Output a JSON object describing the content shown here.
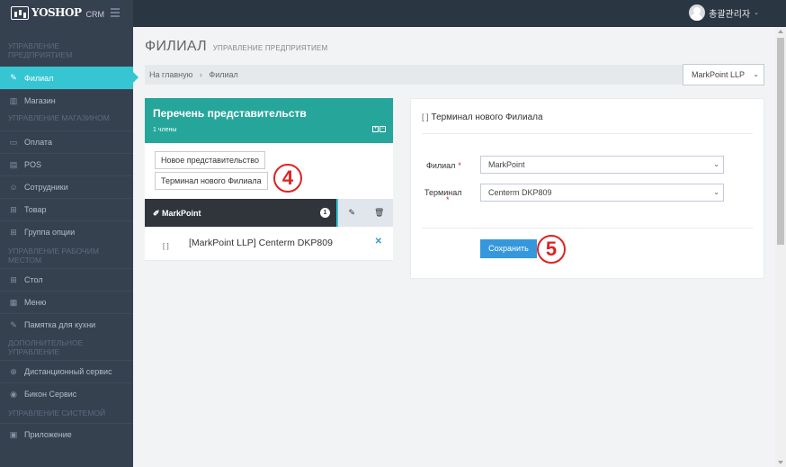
{
  "brand": {
    "name": "YOSHOP",
    "suffix": "CRM"
  },
  "user": {
    "name": "총괄관리자"
  },
  "sidebar": {
    "sections": [
      {
        "heading": "УПРАВЛЕНИЕ ПРЕДПРИЯТИЕМ",
        "items": [
          {
            "label": "Филиал",
            "icon": "edit-icon",
            "active": true
          },
          {
            "label": "Магазин",
            "icon": "store-icon"
          }
        ]
      },
      {
        "heading": "УПРАВЛЕНИЕ МАГАЗИНОМ",
        "items": [
          {
            "label": "Оплата",
            "icon": "credit-card-icon"
          },
          {
            "label": "POS",
            "icon": "pos-icon"
          },
          {
            "label": "Сотрудники",
            "icon": "users-icon"
          },
          {
            "label": "Товар",
            "icon": "cart-icon"
          },
          {
            "label": "Группа опции",
            "icon": "cart-options-icon"
          }
        ]
      },
      {
        "heading": "УПРАВЛЕНИЕ РАБОЧИМ МЕСТОМ",
        "items": [
          {
            "label": "Стол",
            "icon": "grid-icon"
          },
          {
            "label": "Меню",
            "icon": "menu-book-icon"
          },
          {
            "label": "Памятка для кухни",
            "icon": "note-icon"
          }
        ]
      },
      {
        "heading": "ДОПОЛНИТЕЛЬНОЕ УПРАВЛЕНИЕ",
        "items": [
          {
            "label": "Дистанционный сервис",
            "icon": "globe-icon"
          },
          {
            "label": "Бикон Сервис",
            "icon": "location-icon"
          }
        ]
      },
      {
        "heading": "УПРАВЛЕНИЕ СИСТЕМОЙ",
        "items": [
          {
            "label": "Приложение",
            "icon": "app-icon"
          }
        ]
      }
    ]
  },
  "page": {
    "title": "ФИЛИАЛ",
    "subtitle": "УПРАВЛЕНИЕ ПРЕДПРИЯТИЕМ"
  },
  "breadcrumb": {
    "home": "На главную",
    "current": "Филиал"
  },
  "company_select": {
    "value": "MarkPoint LLP"
  },
  "reps_panel": {
    "title": "Перечень представительств",
    "count": "1 члены",
    "new_rep_button": "Новое представительство",
    "new_terminal_button": "Терминал нового Филиала",
    "step_badge": "4",
    "rep": {
      "name": "MarkPoint",
      "badge": "1"
    },
    "terminal": {
      "name": "[MarkPoint LLP] Centerm DKP809"
    }
  },
  "form_panel": {
    "title": "Терминал нового Филиала",
    "branch_label": "Филиал",
    "branch_value": "MarkPoint",
    "terminal_label": "Терминал",
    "terminal_value": "Centerm DKP809",
    "required_mark": "*",
    "save_button": "Сохранить",
    "step_badge": "5"
  }
}
